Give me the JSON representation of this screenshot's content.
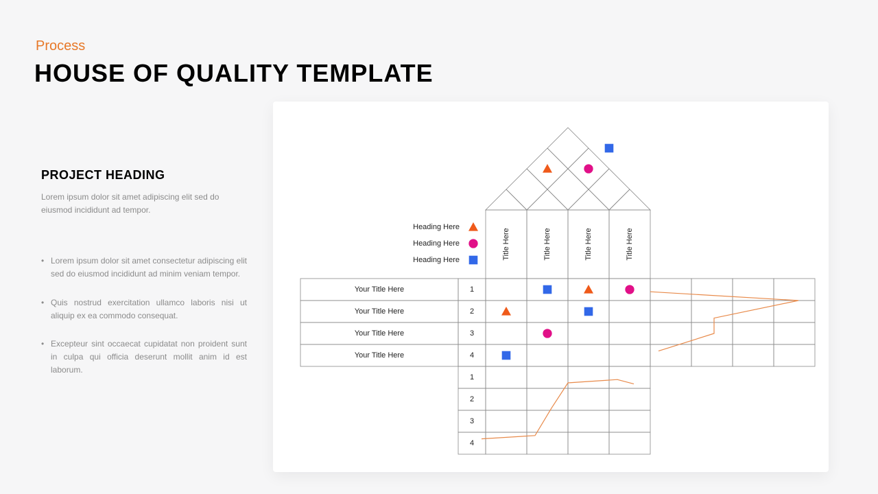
{
  "header": {
    "kicker": "Process",
    "title": "HOUSE OF QUALITY TEMPLATE"
  },
  "sidebar": {
    "heading": "PROJECT HEADING",
    "lead": "Lorem ipsum dolor sit amet adipiscing  elit sed do eiusmod incididunt ad tempor.",
    "bullets": [
      "Lorem ipsum dolor sit amet consectetur adipiscing elit sed do eiusmod incididunt ad minim veniam tempor.",
      "Quis nostrud exercitation ullamco laboris nisi ut aliquip ex ea commodo consequat.",
      "Excepteur sint occaecat cupidatat non proident sunt in culpa qui officia deserunt mollit anim id est laborum."
    ]
  },
  "colors": {
    "triangle": "#ef5a1a",
    "circle": "#e11088",
    "square": "#3268e8",
    "line": "#e88a4a",
    "grid": "#8a8a8a"
  },
  "legend": {
    "items": [
      {
        "label": "Heading Here",
        "shape": "triangle"
      },
      {
        "label": "Heading Here",
        "shape": "circle"
      },
      {
        "label": "Heading Here",
        "shape": "square"
      }
    ]
  },
  "columns": {
    "titles": [
      "Title Here",
      "Title Here",
      "Title Here",
      "Title Here"
    ]
  },
  "rows": [
    {
      "label": "Your Title Here",
      "num": "1"
    },
    {
      "label": "Your Title Here",
      "num": "2"
    },
    {
      "label": "Your Title Here",
      "num": "3"
    },
    {
      "label": "Your Title Here",
      "num": "4"
    }
  ],
  "bottomNums": [
    "1",
    "2",
    "3",
    "4"
  ],
  "roof": {
    "shapes": [
      {
        "shape": "square",
        "row": 0,
        "col": 1
      },
      {
        "shape": "triangle",
        "row": 1,
        "col": 0
      },
      {
        "shape": "circle",
        "row": 1,
        "col": 1
      }
    ]
  },
  "matrix": {
    "cells": [
      {
        "row": 0,
        "col": 1,
        "shape": "square"
      },
      {
        "row": 0,
        "col": 2,
        "shape": "triangle"
      },
      {
        "row": 0,
        "col": 3,
        "shape": "circle"
      },
      {
        "row": 1,
        "col": 0,
        "shape": "triangle"
      },
      {
        "row": 1,
        "col": 2,
        "shape": "square"
      },
      {
        "row": 2,
        "col": 1,
        "shape": "circle"
      },
      {
        "row": 3,
        "col": 0,
        "shape": "square"
      }
    ]
  },
  "priorityRight": {
    "points": [
      {
        "c": 0,
        "r": 0.6
      },
      {
        "c": 3.6,
        "r": 1.0
      },
      {
        "c": 1.55,
        "r": 1.8
      },
      {
        "c": 1.55,
        "r": 2.5
      },
      {
        "c": 0.2,
        "r": 3.3
      }
    ]
  },
  "priorityBottom": {
    "points": [
      {
        "c": -0.1,
        "r": 3.3
      },
      {
        "c": 1.2,
        "r": 3.15
      },
      {
        "c": 1.6,
        "r": 1.9
      },
      {
        "c": 2.0,
        "r": 0.75
      },
      {
        "c": 3.2,
        "r": 0.6
      },
      {
        "c": 3.6,
        "r": 0.8
      }
    ]
  }
}
